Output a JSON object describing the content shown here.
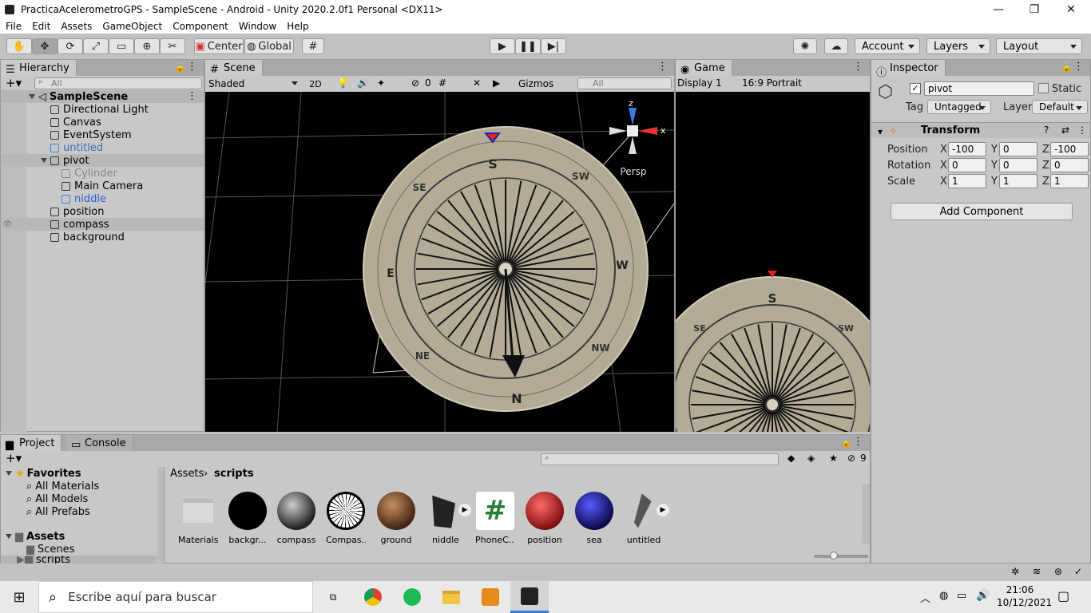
{
  "window": {
    "title": "PracticaAcelerometroGPS - SampleScene - Android - Unity 2020.2.0f1 Personal <DX11>",
    "minimize": "—",
    "maximize": "❐",
    "close": "✕"
  },
  "menu": [
    "File",
    "Edit",
    "Assets",
    "GameObject",
    "Component",
    "Window",
    "Help"
  ],
  "toolbar": {
    "pivot_mode": "Center",
    "pivot_space": "Global",
    "account": "Account",
    "layers": "Layers",
    "layout": "Layout"
  },
  "hierarchy": {
    "tab": "Hierarchy",
    "search_placeholder": "All",
    "scene": "SampleScene",
    "items": [
      {
        "label": "Directional Light"
      },
      {
        "label": "Canvas"
      },
      {
        "label": "EventSystem"
      },
      {
        "label": "untitled"
      },
      {
        "label": "pivot"
      },
      {
        "label": "Cylinder"
      },
      {
        "label": "Main Camera"
      },
      {
        "label": "niddle"
      },
      {
        "label": "position"
      },
      {
        "label": "compass"
      },
      {
        "label": "background"
      }
    ]
  },
  "scene": {
    "tab": "Scene",
    "shading": "Shaded",
    "mode_2d": "2D",
    "hidden_count": "0",
    "gizmos": "Gizmos",
    "search_placeholder": "All",
    "persp": "Persp",
    "axis_x": "x",
    "axis_z": "z",
    "compass_south": "S",
    "compass_north": "N",
    "compass_east": "E",
    "compass_west": "W",
    "compass_se": "SE",
    "compass_sw": "SW",
    "compass_ne": "NE",
    "compass_nw": "NW"
  },
  "game": {
    "tab": "Game",
    "display": "Display 1",
    "aspect": "16:9 Portrait",
    "compass_south": "S",
    "compass_se": "SE",
    "compass_sw": "SW"
  },
  "inspector": {
    "tab": "Inspector",
    "object_name": "pivot",
    "static_label": "Static",
    "tag_label": "Tag",
    "tag_value": "Untagged",
    "layer_label": "Layer",
    "layer_value": "Default",
    "component": "Transform",
    "position_label": "Position",
    "rotation_label": "Rotation",
    "scale_label": "Scale",
    "x": "X",
    "y": "Y",
    "z": "Z",
    "position": {
      "x": "-100",
      "y": "0",
      "z": "-100"
    },
    "rotation": {
      "x": "0",
      "y": "0",
      "z": "0"
    },
    "scale": {
      "x": "1",
      "y": "1",
      "z": "1"
    },
    "add_component": "Add Component"
  },
  "project": {
    "tab": "Project",
    "console_tab": "Console",
    "hidden_count": "9",
    "favorites": "Favorites",
    "fav_items": [
      "All Materials",
      "All Models",
      "All Prefabs"
    ],
    "assets_root": "Assets",
    "folders": [
      "Scenes",
      "scripts"
    ],
    "breadcrumb_root": "Assets",
    "breadcrumb_current": "scripts",
    "assets": [
      {
        "name": "Materials",
        "color": "#d9d9d9"
      },
      {
        "name": "backgr...",
        "color": "#000000"
      },
      {
        "name": "compass",
        "color": "#2a2a2a"
      },
      {
        "name": "Compas...",
        "color": "#ffffff"
      },
      {
        "name": "ground",
        "color": "#7a4a2a"
      },
      {
        "name": "niddle",
        "color": "#333333"
      },
      {
        "name": "PhoneC...",
        "color": "#ffffff"
      },
      {
        "name": "position",
        "color": "#c0141a"
      },
      {
        "name": "sea",
        "color": "#10108a"
      },
      {
        "name": "untitled",
        "color": "#444444"
      }
    ],
    "script_glyph": "#"
  },
  "taskbar": {
    "search_placeholder": "Escribe aquí para buscar",
    "time": "21:06",
    "date": "10/12/2021"
  }
}
